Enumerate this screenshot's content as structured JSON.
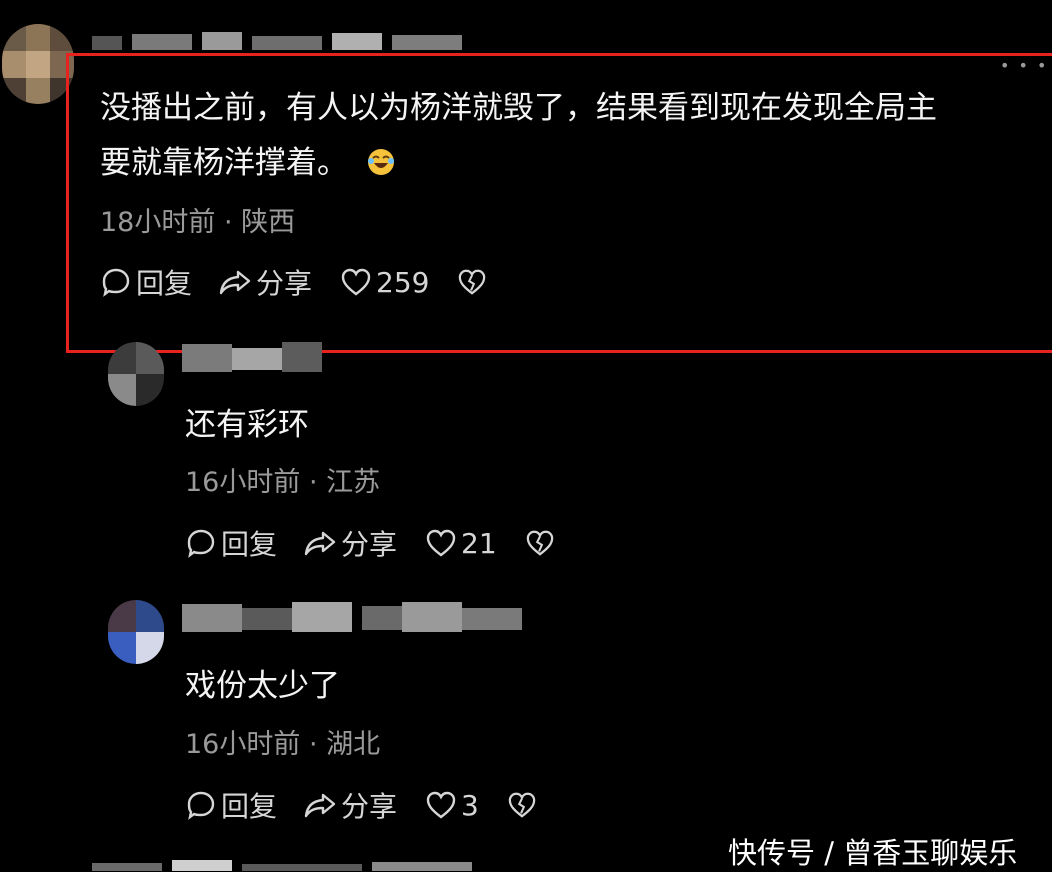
{
  "comments": [
    {
      "text_line1": "没播出之前，有人以为杨洋就毁了，结果看到现在发现全局主",
      "text_line2": "要就靠杨洋撑着。",
      "emoji_icon": "laughing-crying-face-icon",
      "meta": "18小时前 · 陕西",
      "reply_label": "回复",
      "share_label": "分享",
      "like_count": "259"
    },
    {
      "text": "还有彩环",
      "meta": "16小时前 · 江苏",
      "reply_label": "回复",
      "share_label": "分享",
      "like_count": "21"
    },
    {
      "text": "戏份太少了",
      "meta": "16小时前 · 湖北",
      "reply_label": "回复",
      "share_label": "分享",
      "like_count": "3"
    }
  ],
  "more_icon": "more-dots-icon",
  "watermark": "快传号 / 曾香玉聊娱乐",
  "colors": {
    "background": "#000000",
    "highlight_border": "#e8231f",
    "meta_text": "#9a9a9a",
    "body_text": "#f4f4f4"
  }
}
